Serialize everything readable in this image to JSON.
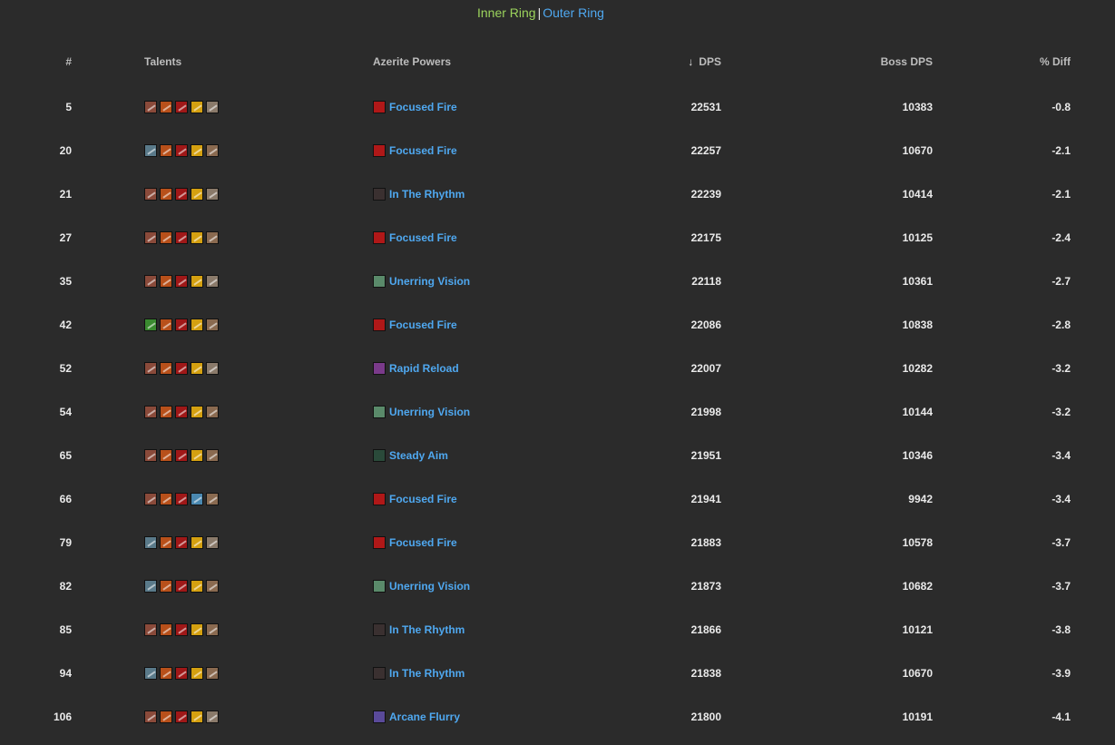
{
  "top": {
    "inner_ring": "Inner Ring",
    "separator": "|",
    "outer_ring": "Outer Ring"
  },
  "columns": {
    "num": "#",
    "talents": "Talents",
    "azerite": "Azerite Powers",
    "dps_sort_icon": "↓",
    "dps": "DPS",
    "boss_dps": "Boss DPS",
    "diff": "% Diff"
  },
  "colors": {
    "inner_ring": "#9bd35c",
    "link": "#4fa8f0",
    "background": "#2b2b2b"
  },
  "icon_palette": {
    "careful-aim-icon": "#8a4a3a",
    "serpent-sting-icon": "#5a7a8a",
    "barrage-icon": "#b8501a",
    "steady-focus-icon": "#a01818",
    "lock-and-load-icon": "#d4a010",
    "streamline-icon": "#4a88b0",
    "calling-the-shots-icon": "#8a7a6a",
    "lethal-shots-icon": "#8a6a50",
    "master-marksman-icon": "#3a8a30",
    "focused-fire-icon": "#b01818",
    "in-the-rhythm-icon": "#3a3030",
    "unerring-vision-icon": "#5a8a6a",
    "rapid-reload-icon": "#7a3a8a",
    "steady-aim-icon": "#2a4a3a",
    "arcane-flurry-icon": "#5a4a9a"
  },
  "rows": [
    {
      "rank": "5",
      "talents": [
        "careful-aim-icon",
        "barrage-icon",
        "steady-focus-icon",
        "lock-and-load-icon",
        "calling-the-shots-icon"
      ],
      "azerite_icon": "focused-fire-icon",
      "azerite": "Focused Fire",
      "dps": "22531",
      "boss_dps": "10383",
      "diff": "-0.8"
    },
    {
      "rank": "20",
      "talents": [
        "serpent-sting-icon",
        "barrage-icon",
        "steady-focus-icon",
        "lock-and-load-icon",
        "lethal-shots-icon"
      ],
      "azerite_icon": "focused-fire-icon",
      "azerite": "Focused Fire",
      "dps": "22257",
      "boss_dps": "10670",
      "diff": "-2.1"
    },
    {
      "rank": "21",
      "talents": [
        "careful-aim-icon",
        "barrage-icon",
        "steady-focus-icon",
        "lock-and-load-icon",
        "calling-the-shots-icon"
      ],
      "azerite_icon": "in-the-rhythm-icon",
      "azerite": "In The Rhythm",
      "dps": "22239",
      "boss_dps": "10414",
      "diff": "-2.1"
    },
    {
      "rank": "27",
      "talents": [
        "careful-aim-icon",
        "barrage-icon",
        "steady-focus-icon",
        "lock-and-load-icon",
        "lethal-shots-icon"
      ],
      "azerite_icon": "focused-fire-icon",
      "azerite": "Focused Fire",
      "dps": "22175",
      "boss_dps": "10125",
      "diff": "-2.4"
    },
    {
      "rank": "35",
      "talents": [
        "careful-aim-icon",
        "barrage-icon",
        "steady-focus-icon",
        "lock-and-load-icon",
        "calling-the-shots-icon"
      ],
      "azerite_icon": "unerring-vision-icon",
      "azerite": "Unerring Vision",
      "dps": "22118",
      "boss_dps": "10361",
      "diff": "-2.7"
    },
    {
      "rank": "42",
      "talents": [
        "master-marksman-icon",
        "barrage-icon",
        "steady-focus-icon",
        "lock-and-load-icon",
        "lethal-shots-icon"
      ],
      "azerite_icon": "focused-fire-icon",
      "azerite": "Focused Fire",
      "dps": "22086",
      "boss_dps": "10838",
      "diff": "-2.8"
    },
    {
      "rank": "52",
      "talents": [
        "careful-aim-icon",
        "barrage-icon",
        "steady-focus-icon",
        "lock-and-load-icon",
        "calling-the-shots-icon"
      ],
      "azerite_icon": "rapid-reload-icon",
      "azerite": "Rapid Reload",
      "dps": "22007",
      "boss_dps": "10282",
      "diff": "-3.2"
    },
    {
      "rank": "54",
      "talents": [
        "careful-aim-icon",
        "barrage-icon",
        "steady-focus-icon",
        "lock-and-load-icon",
        "lethal-shots-icon"
      ],
      "azerite_icon": "unerring-vision-icon",
      "azerite": "Unerring Vision",
      "dps": "21998",
      "boss_dps": "10144",
      "diff": "-3.2"
    },
    {
      "rank": "65",
      "talents": [
        "careful-aim-icon",
        "barrage-icon",
        "steady-focus-icon",
        "lock-and-load-icon",
        "lethal-shots-icon"
      ],
      "azerite_icon": "steady-aim-icon",
      "azerite": "Steady Aim",
      "dps": "21951",
      "boss_dps": "10346",
      "diff": "-3.4"
    },
    {
      "rank": "66",
      "talents": [
        "careful-aim-icon",
        "barrage-icon",
        "steady-focus-icon",
        "streamline-icon",
        "lethal-shots-icon"
      ],
      "azerite_icon": "focused-fire-icon",
      "azerite": "Focused Fire",
      "dps": "21941",
      "boss_dps": "9942",
      "diff": "-3.4"
    },
    {
      "rank": "79",
      "talents": [
        "serpent-sting-icon",
        "barrage-icon",
        "steady-focus-icon",
        "lock-and-load-icon",
        "calling-the-shots-icon"
      ],
      "azerite_icon": "focused-fire-icon",
      "azerite": "Focused Fire",
      "dps": "21883",
      "boss_dps": "10578",
      "diff": "-3.7"
    },
    {
      "rank": "82",
      "talents": [
        "serpent-sting-icon",
        "barrage-icon",
        "steady-focus-icon",
        "lock-and-load-icon",
        "lethal-shots-icon"
      ],
      "azerite_icon": "unerring-vision-icon",
      "azerite": "Unerring Vision",
      "dps": "21873",
      "boss_dps": "10682",
      "diff": "-3.7"
    },
    {
      "rank": "85",
      "talents": [
        "careful-aim-icon",
        "barrage-icon",
        "steady-focus-icon",
        "lock-and-load-icon",
        "lethal-shots-icon"
      ],
      "azerite_icon": "in-the-rhythm-icon",
      "azerite": "In The Rhythm",
      "dps": "21866",
      "boss_dps": "10121",
      "diff": "-3.8"
    },
    {
      "rank": "94",
      "talents": [
        "serpent-sting-icon",
        "barrage-icon",
        "steady-focus-icon",
        "lock-and-load-icon",
        "lethal-shots-icon"
      ],
      "azerite_icon": "in-the-rhythm-icon",
      "azerite": "In The Rhythm",
      "dps": "21838",
      "boss_dps": "10670",
      "diff": "-3.9"
    },
    {
      "rank": "106",
      "talents": [
        "careful-aim-icon",
        "barrage-icon",
        "steady-focus-icon",
        "lock-and-load-icon",
        "calling-the-shots-icon"
      ],
      "azerite_icon": "arcane-flurry-icon",
      "azerite": "Arcane Flurry",
      "dps": "21800",
      "boss_dps": "10191",
      "diff": "-4.1"
    }
  ]
}
